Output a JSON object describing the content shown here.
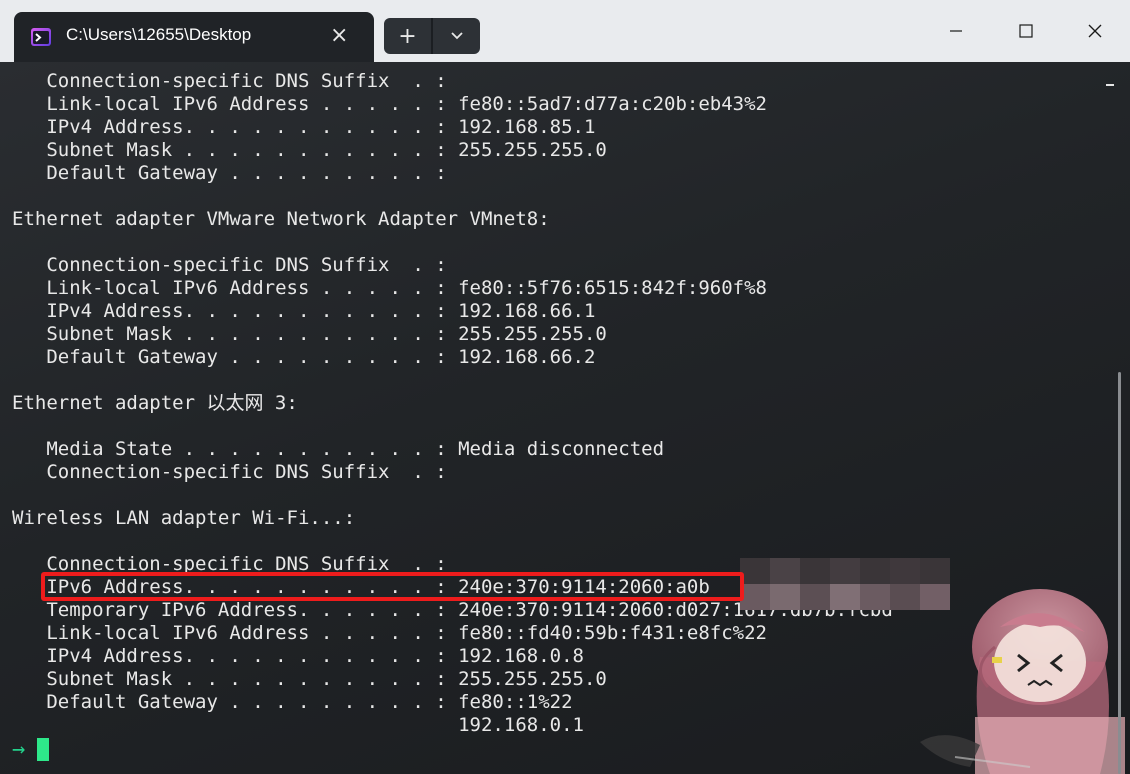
{
  "window": {
    "tab_title": "C:\\Users\\12655\\Desktop",
    "tab_close_icon": "×",
    "new_tab_icon": "+",
    "dropdown_icon": "⌄"
  },
  "terminal": {
    "lines": [
      "   Connection-specific DNS Suffix  . :",
      "   Link-local IPv6 Address . . . . . : fe80::5ad7:d77a:c20b:eb43%2",
      "   IPv4 Address. . . . . . . . . . . : 192.168.85.1",
      "   Subnet Mask . . . . . . . . . . . : 255.255.255.0",
      "   Default Gateway . . . . . . . . . :",
      "",
      "Ethernet adapter VMware Network Adapter VMnet8:",
      "",
      "   Connection-specific DNS Suffix  . :",
      "   Link-local IPv6 Address . . . . . : fe80::5f76:6515:842f:960f%8",
      "   IPv4 Address. . . . . . . . . . . : 192.168.66.1",
      "   Subnet Mask . . . . . . . . . . . : 255.255.255.0",
      "   Default Gateway . . . . . . . . . : 192.168.66.2",
      "",
      "Ethernet adapter 以太网 3:",
      "",
      "   Media State . . . . . . . . . . . : Media disconnected",
      "   Connection-specific DNS Suffix  . :",
      "",
      "Wireless LAN adapter Wi-Fi...:",
      "",
      "   Connection-specific DNS Suffix  . :",
      "   IPv6 Address. . . . . . . . . . . : 240e:370:9114:2060:a0b",
      "   Temporary IPv6 Address. . . . . . : 240e:370:9114:2060:d027:1617:db7b:fcbd",
      "   Link-local IPv6 Address . . . . . : fe80::fd40:59b:f431:e8fc%22",
      "   IPv4 Address. . . . . . . . . . . : 192.168.0.8",
      "   Subnet Mask . . . . . . . . . . . : 255.255.255.0",
      "   Default Gateway . . . . . . . . . : fe80::1%22",
      "                                       192.168.0.1"
    ],
    "prompt_symbol": "→"
  },
  "colors": {
    "titlebar_bg": "#e9ebee",
    "tab_bg": "#202327",
    "terminal_bg": "#1f2225",
    "text": "#e8e8e8",
    "prompt": "#23d18b",
    "highlight": "#ee1c1c"
  }
}
